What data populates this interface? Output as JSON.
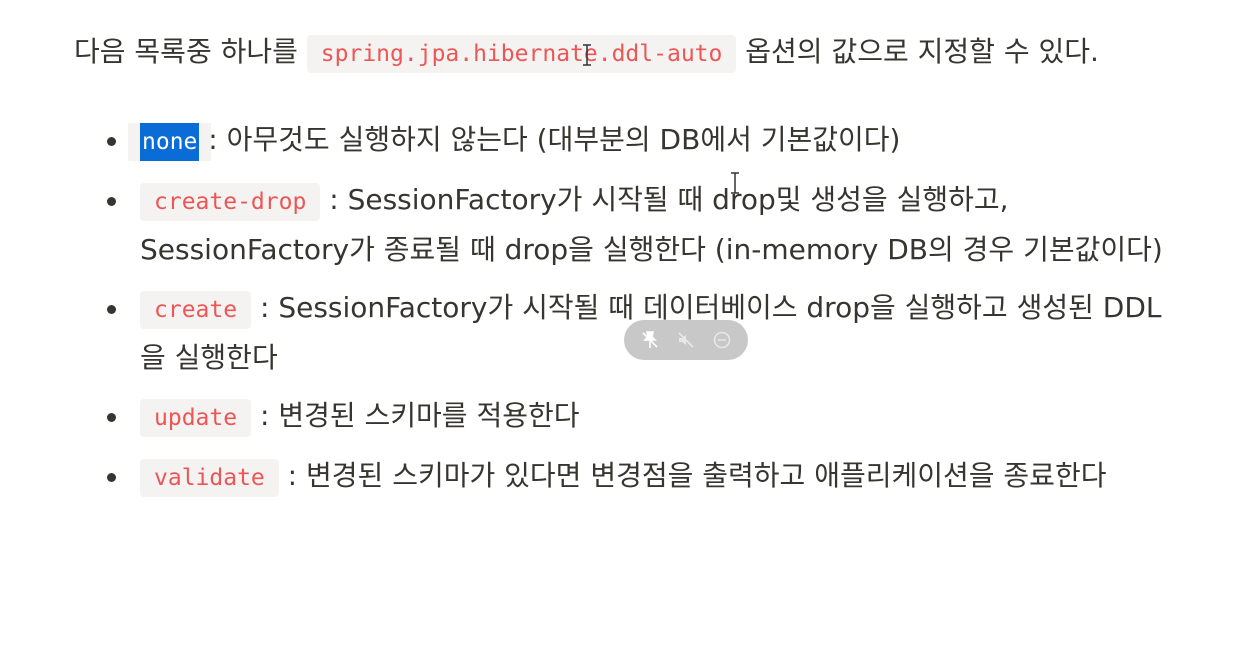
{
  "intro": {
    "before": "다음 목록중 하나를 ",
    "code": "spring.jpa.hibernate.ddl-auto",
    "after": " 옵션의 값으로 지정할 수 있다."
  },
  "items": [
    {
      "code": "none",
      "text": " : 아무것도 실행하지 않는다 (대부분의 DB에서 기본값이다)"
    },
    {
      "code": "create-drop",
      "text": " : SessionFactory가 시작될 때 drop및 생성을 실행하고, SessionFactory가 종료될 때 drop을 실행한다 (in-memory DB의 경우 기본값이다)"
    },
    {
      "code": "create",
      "text": " : SessionFactory가 시작될 때 데이터베이스 drop을 실행하고 생성된 DDL을 실행한다"
    },
    {
      "code": "update",
      "text": " : 변경된 스키마를 적용한다"
    },
    {
      "code": "validate",
      "text": " : 변경된 스키마가 있다면 변경점을 출력하고 애플리케이션을 종료한다"
    }
  ],
  "overlay_icons": [
    "unpin-icon",
    "mute-icon",
    "minus-circle-icon"
  ],
  "colors": {
    "code_text": "#eb5757",
    "code_bg": "#f4f3f1",
    "selection": "#0a6cd6",
    "body_text": "#37352f"
  }
}
